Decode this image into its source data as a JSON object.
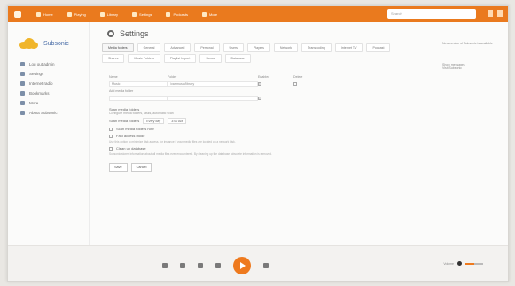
{
  "app": {
    "name": "Subsonic",
    "page_title": "Settings"
  },
  "topbar": {
    "nav": [
      "Home",
      "Playing",
      "Library",
      "Settings",
      "Podcasts",
      "More"
    ],
    "search_placeholder": "Search"
  },
  "sidebar": {
    "items": [
      {
        "label": "Log out admin",
        "icon": "logout-icon"
      },
      {
        "label": "Settings",
        "icon": "gear-icon"
      },
      {
        "label": "Internet radio",
        "icon": "radio-icon"
      },
      {
        "label": "Bookmarks",
        "icon": "bookmark-icon"
      },
      {
        "label": "More",
        "icon": "more-icon"
      },
      {
        "label": "About Subsonic",
        "icon": "info-icon"
      }
    ]
  },
  "settings": {
    "tabs": [
      "Media folders",
      "General",
      "Advanced",
      "Personal",
      "Users",
      "Players",
      "Network",
      "Transcoding",
      "Internet TV",
      "Podcast",
      "Shares",
      "Music Folders",
      "Playlist Import",
      "Sonos",
      "Database"
    ],
    "table_headers": [
      "Name",
      "Folder",
      "Enabled",
      "Delete"
    ],
    "rows": [
      {
        "name": "Music",
        "folder": "/var/music/library",
        "enabled": true,
        "delete": false
      },
      {
        "name": "",
        "folder": "",
        "enabled": true,
        "delete": false
      }
    ],
    "add_label": "Add media folder",
    "manage_label": "Manage",
    "scan_section_title": "Scan media folders",
    "scan_subtitle": "Configure media folders, tasks, automatic scan",
    "scan_every_label": "Scan media folders",
    "scan_every_value": "Every day",
    "scan_time_value": "3:00 AM",
    "scan_now_label": "Scan media folders now",
    "fast_cache_title": "Fast access mode",
    "fast_cache_desc": "Use this option to minimize disk access, for instance if your media files are located on a network disk.",
    "cleanup_title": "Clean up database",
    "cleanup_desc": "Subsonic stores information about all media files ever encountered. By cleaning up the database, obsolete information is removed.",
    "save_button": "Save",
    "cancel_button": "Cancel"
  },
  "right_panel": {
    "update_notice": "New version of Subsonic is available",
    "help_label": "Show messages",
    "help_sub": "Visit Subsonic"
  },
  "player": {
    "volume_label": "Volume",
    "volume_level": 0.5
  },
  "colors": {
    "accent": "#ea7a1e",
    "brand_cloud": "#f0b52a"
  }
}
